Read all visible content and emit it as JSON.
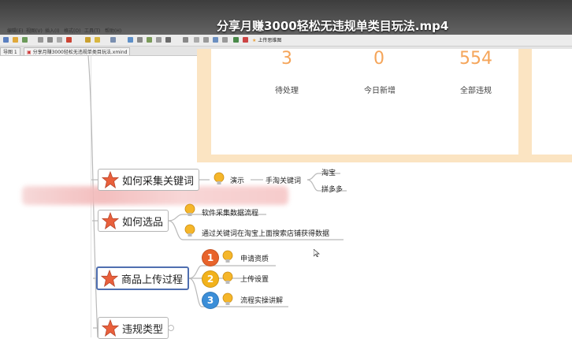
{
  "video": {
    "title": "分享月赚3000轻松无违规单类目玩法.mp4"
  },
  "menu": [
    "编辑(E)",
    "视图(V)",
    "插入(I)",
    "格式(O)",
    "工具(T)",
    "帮助(H)"
  ],
  "toolbar": {
    "map_label": "上传思维图"
  },
  "tabs": [
    {
      "label": "导图 1"
    },
    {
      "label": "分享月赚3000轻松无违规单类目玩法.xmind"
    }
  ],
  "stats": [
    {
      "value": "3",
      "label": "待处理"
    },
    {
      "value": "0",
      "label": "今日新增"
    },
    {
      "value": "554",
      "label": "全部违规"
    }
  ],
  "topics": {
    "collect_keywords": {
      "label": "如何采集关键词",
      "demo": "演示",
      "method": "手淘关键词",
      "sources": [
        "淘宝",
        "拼多多"
      ]
    },
    "select_products": {
      "label": "如何选品",
      "items": [
        "软件采集数据流程",
        "通过关键词在淘宝上面搜索店铺获得数据"
      ]
    },
    "upload_process": {
      "label": "商品上传过程",
      "steps": [
        {
          "num": "1",
          "label": "申请资质",
          "color": "#e8632b"
        },
        {
          "num": "2",
          "label": "上传设置",
          "color": "#f2b21b"
        },
        {
          "num": "3",
          "label": "流程实操讲解",
          "color": "#3b8ed8"
        }
      ]
    },
    "violation_types": {
      "label": "违规类型"
    }
  },
  "colors": {
    "star": "#e9603c",
    "bulb": "#f5b62a",
    "selection": "#4f6fb0",
    "stat_number": "#f5a55a"
  }
}
